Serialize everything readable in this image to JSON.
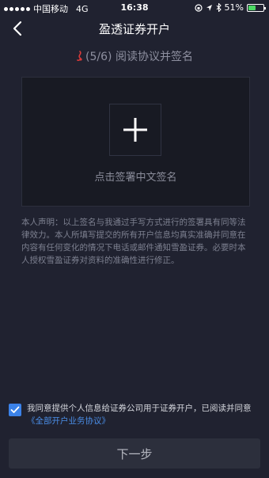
{
  "status_bar": {
    "carrier": "中国移动",
    "network": "4G",
    "time": "16:38",
    "battery_percent": "51%",
    "battery_level": 0.51
  },
  "header": {
    "title": "盈透证券开户"
  },
  "step": {
    "text": "(5/6) 阅读协议并签名"
  },
  "sign_area": {
    "hint": "点击签署中文签名"
  },
  "declaration": {
    "text": "本人声明：以上签名与我通过手写方式进行的签署具有同等法律效力。本人所填写提交的所有开户信息均真实准确并同意在内容有任何变化的情况下电话或邮件通知雪盈证券。必要时本人授权雪盈证券对资料的准确性进行修正。"
  },
  "agreement": {
    "text": "我同意提供个人信息给证券公司用于证券开户，已阅读并同意",
    "link": "《全部开户业务协议》",
    "checked": true
  },
  "footer": {
    "next_label": "下一步"
  },
  "colors": {
    "background": "#202230",
    "accent": "#3b82e8",
    "link": "#4a8de6"
  }
}
